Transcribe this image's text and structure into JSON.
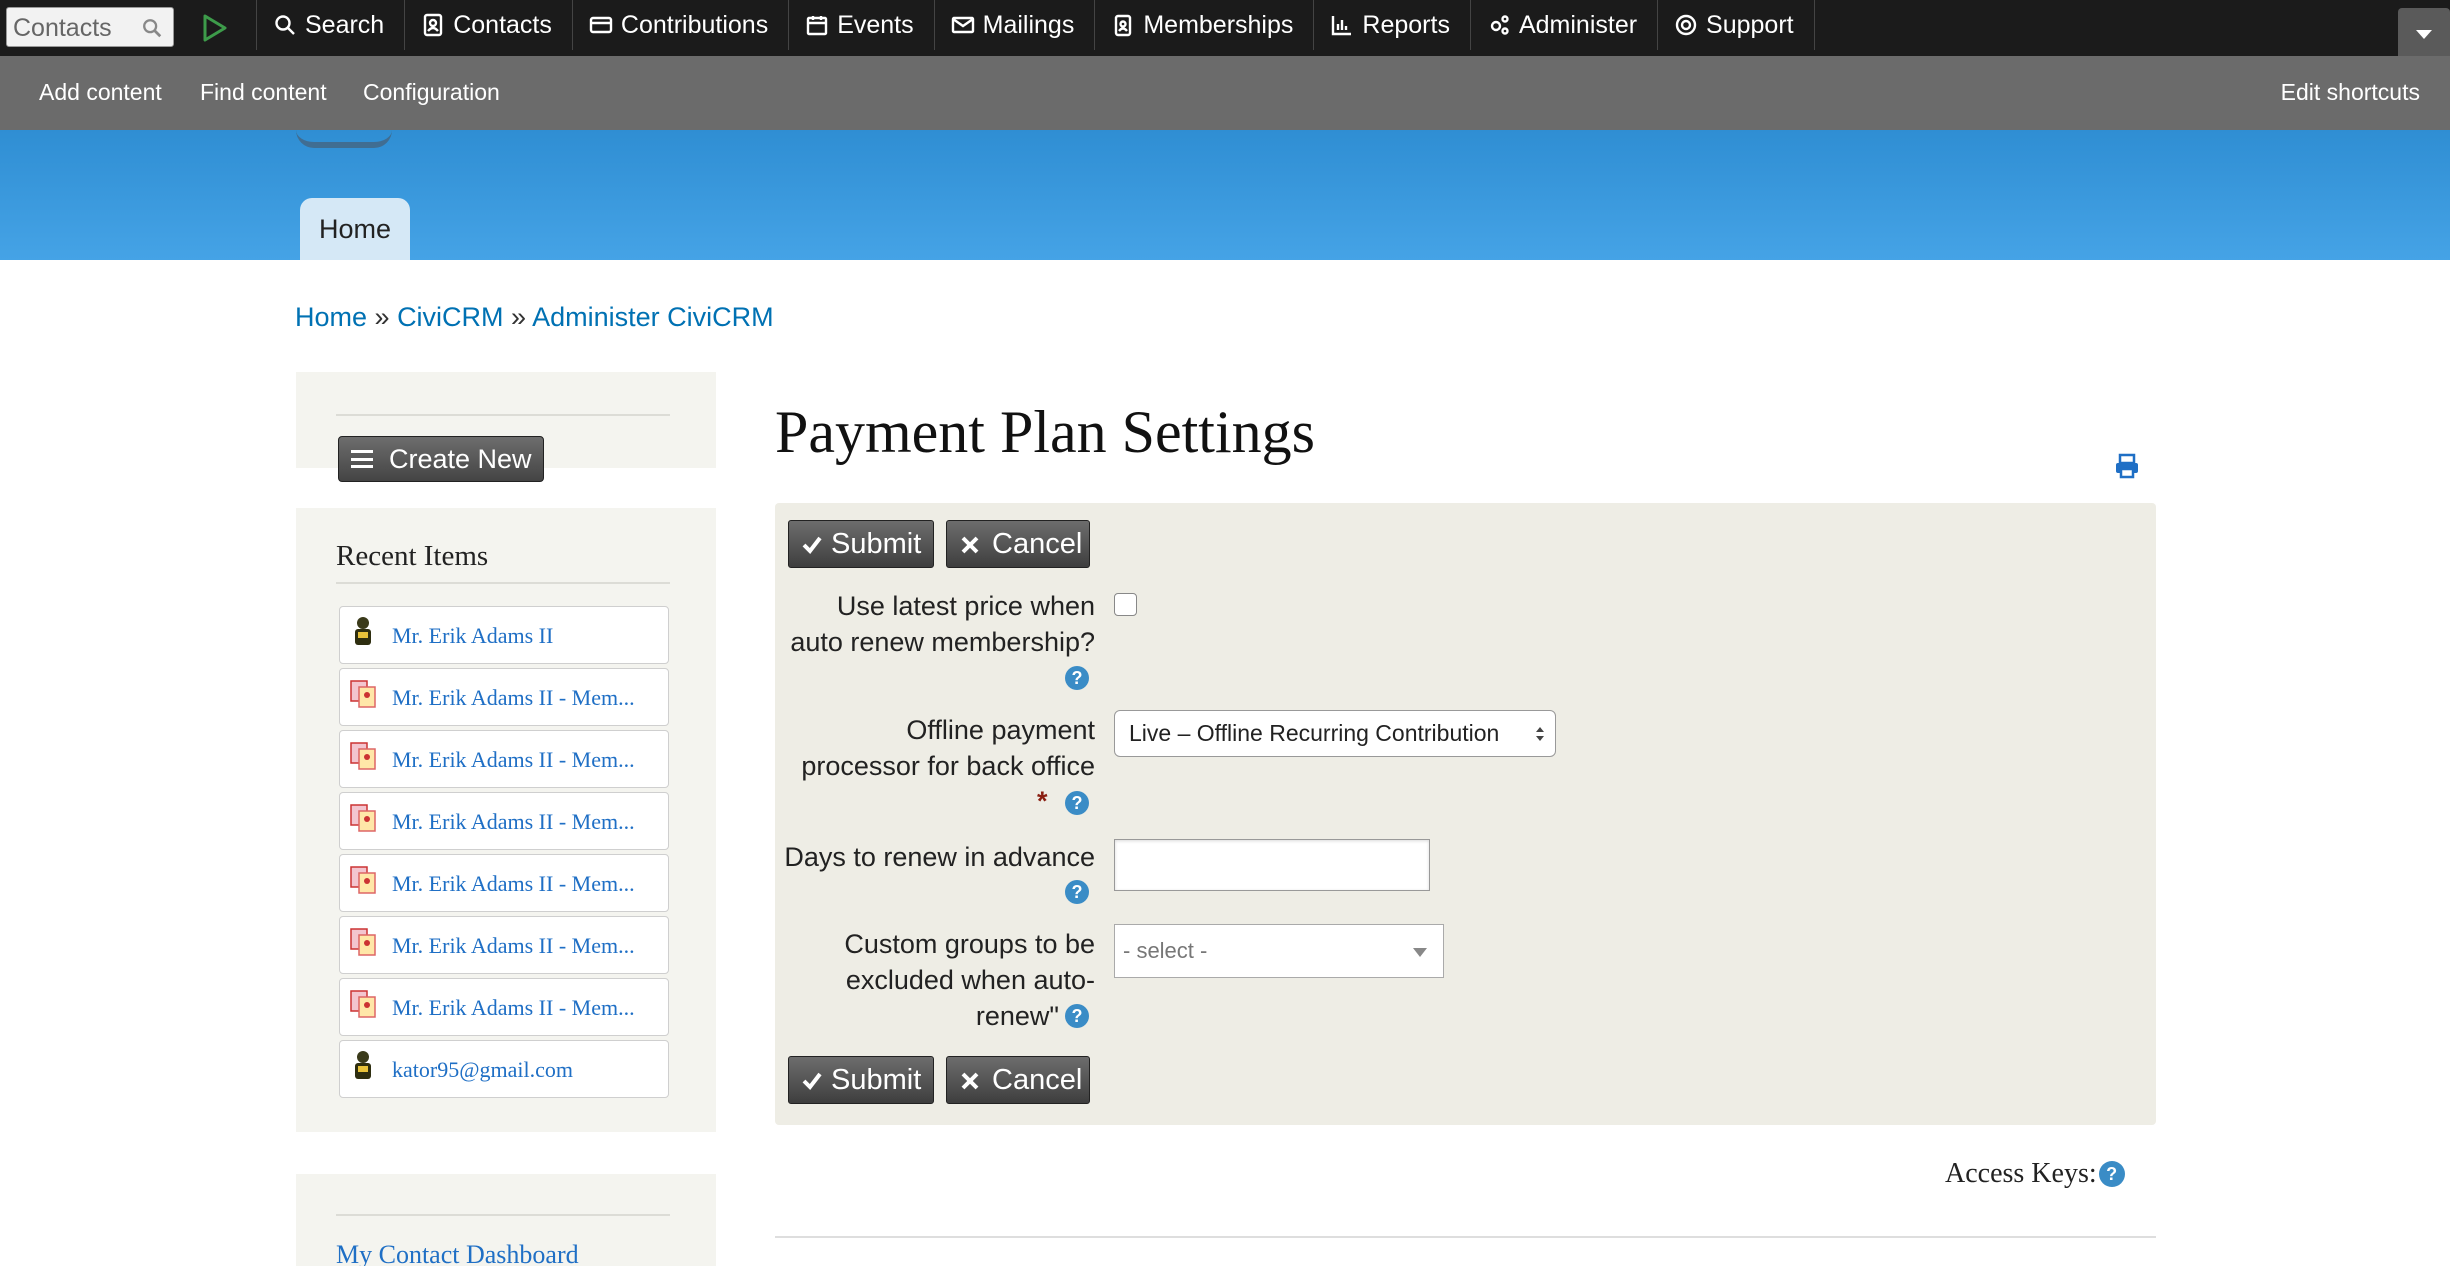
{
  "civi_menu": {
    "quicksearch_placeholder": "Contacts",
    "items": [
      {
        "label": "Search",
        "icon": "search-icon"
      },
      {
        "label": "Contacts",
        "icon": "contacts-icon"
      },
      {
        "label": "Contributions",
        "icon": "credit-card-icon"
      },
      {
        "label": "Events",
        "icon": "calendar-icon"
      },
      {
        "label": "Mailings",
        "icon": "envelope-icon"
      },
      {
        "label": "Memberships",
        "icon": "id-badge-icon"
      },
      {
        "label": "Reports",
        "icon": "bar-chart-icon"
      },
      {
        "label": "Administer",
        "icon": "gears-icon"
      },
      {
        "label": "Support",
        "icon": "life-ring-icon"
      }
    ]
  },
  "shortcuts": {
    "add_content": "Add content",
    "find_content": "Find content",
    "configuration": "Configuration",
    "edit_shortcuts": "Edit shortcuts"
  },
  "header": {
    "home_tab": "Home"
  },
  "breadcrumb": {
    "home": "Home",
    "sep1": " » ",
    "civicrm": "CiviCRM",
    "sep2": " » ",
    "administer": "Administer CiviCRM"
  },
  "sidebar": {
    "create_new": "Create New",
    "recent_title": "Recent Items",
    "recent_items": [
      {
        "label": "Mr. Erik Adams II",
        "icon": "contact-icon"
      },
      {
        "label": "Mr. Erik Adams II - Mem...",
        "icon": "membership-icon"
      },
      {
        "label": "Mr. Erik Adams II - Mem...",
        "icon": "membership-icon"
      },
      {
        "label": "Mr. Erik Adams II - Mem...",
        "icon": "membership-icon"
      },
      {
        "label": "Mr. Erik Adams II - Mem...",
        "icon": "membership-icon"
      },
      {
        "label": "Mr. Erik Adams II - Mem...",
        "icon": "membership-icon"
      },
      {
        "label": "Mr. Erik Adams II - Mem...",
        "icon": "membership-icon"
      },
      {
        "label": "kator95@gmail.com",
        "icon": "contact-icon"
      }
    ],
    "dashboard_link": "My Contact Dashboard"
  },
  "main": {
    "title": "Payment Plan Settings",
    "submit_label": "Submit",
    "cancel_label": "Cancel",
    "fields": {
      "use_latest_price": {
        "label_line1": "Use latest price when",
        "label_line2": "auto renew membership?",
        "checked": false
      },
      "offline_processor": {
        "label_line1": "Offline payment",
        "label_line2": "processor for back office",
        "required_mark": "*",
        "value": "Live – Offline Recurring Contribution"
      },
      "days_in_advance": {
        "label": "Days to renew in advance",
        "value": ""
      },
      "custom_groups": {
        "label_line1": "Custom groups to be",
        "label_line2": "excluded when auto-",
        "label_line3": "renew\"",
        "placeholder": "- select -"
      }
    },
    "help_glyph": "?",
    "access_keys": "Access Keys:"
  },
  "colors": {
    "header_blue": "#3a9be0",
    "link_blue": "#0071b3",
    "help_blue": "#3a8cc6",
    "panel_bg": "#eeede5",
    "required_red": "#8a1f11"
  }
}
